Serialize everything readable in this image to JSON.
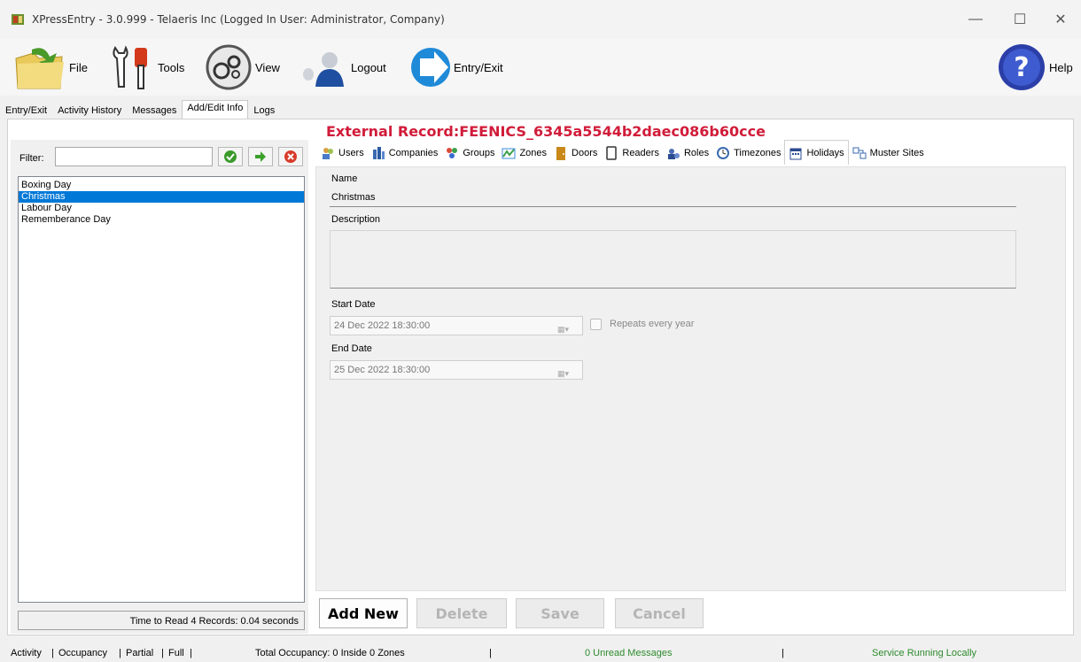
{
  "window": {
    "title": "XPressEntry - 3.0.999 - Telaeris Inc (Logged In User: Administrator, Company)",
    "controls": {
      "minimize": "—",
      "maximize": "☐",
      "close": "✕"
    }
  },
  "toolbar": {
    "file": "File",
    "tools": "Tools",
    "view": "View",
    "logout": "Logout",
    "entry_exit": "Entry/Exit",
    "help": "Help"
  },
  "top_tabs": [
    "Entry/Exit",
    "Activity History",
    "Messages",
    "Add/Edit Info",
    "Logs"
  ],
  "external_record": "External Record:FEENICS_6345a5544b2daec086b60cce",
  "filter": {
    "label": "Filter:",
    "value": ""
  },
  "list": {
    "items": [
      "Boxing Day",
      "Christmas",
      "Labour Day",
      "Rememberance Day"
    ],
    "selected": "Christmas"
  },
  "read_time": "Time to Read 4 Records: 0.04 seconds",
  "sub_tabs": [
    "Users",
    "Companies",
    "Groups",
    "Zones",
    "Doors",
    "Readers",
    "Roles",
    "Timezones",
    "Holidays",
    "Muster Sites"
  ],
  "active_sub_tab": "Holidays",
  "form": {
    "name_label": "Name",
    "name_value": "Christmas",
    "description_label": "Description",
    "description_value": "",
    "start_label": "Start Date",
    "start_value": "24 Dec 2022 18:30:00",
    "repeats_label": "Repeats every year",
    "end_label": "End Date",
    "end_value": "25 Dec 2022 18:30:00"
  },
  "buttons": {
    "add_new": "Add New",
    "delete": "Delete",
    "save": "Save",
    "cancel": "Cancel"
  },
  "status": {
    "activity": "Activity",
    "occupancy": "Occupancy",
    "partial": "Partial",
    "full": "Full",
    "total_occupancy": "Total Occupancy: 0 Inside 0 Zones",
    "unread": "0 Unread Messages",
    "service": "Service Running Locally"
  },
  "colors": {
    "accent": "#0078d7",
    "record": "#d11c3a",
    "status_ok": "#2e8b2e"
  }
}
